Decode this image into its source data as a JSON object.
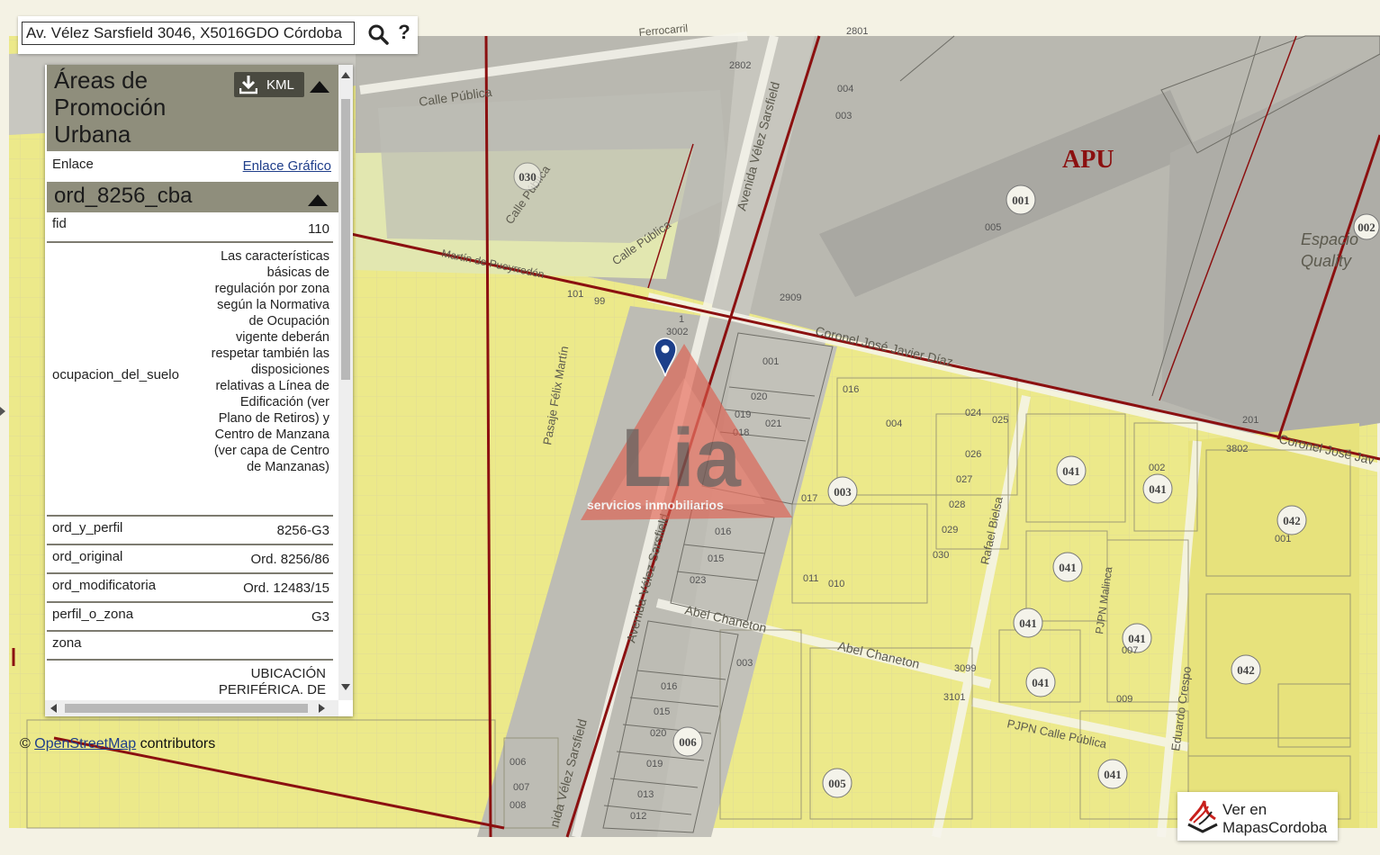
{
  "search": {
    "value": "Av. Vélez Sarsfield 3046, X5016GDO Córdoba",
    "help_label": "?"
  },
  "panel": {
    "title": "Áreas de Promoción Urbana",
    "kml_label": "KML",
    "enlace_label": "Enlace",
    "enlace_link": "Enlace Gráfico",
    "layer_title": "ord_8256_cba",
    "fields": {
      "fid": {
        "key": "fid",
        "value": "110"
      },
      "ocupacion_del_suelo": {
        "key": "ocupacion_del_suelo",
        "value": "Las características básicas de regulación por zona según la Normativa de Ocupación vigente deberán respetar también las disposiciones relativas a Línea de Edificación (ver Plano de Retiros) y Centro de Manzana (ver capa de Centro de Manzanas)"
      },
      "ord_y_perfil": {
        "key": "ord_y_perfil",
        "value": "8256-G3"
      },
      "ord_original": {
        "key": "ord_original",
        "value": "Ord. 8256/86"
      },
      "ord_modificatoria": {
        "key": "ord_modificatoria",
        "value": "Ord. 12483/15"
      },
      "perfil_o_zona": {
        "key": "perfil_o_zona",
        "value": "G3"
      },
      "zona": {
        "key": "zona",
        "value": "UBICACIÓN PERIFÉRICA. DE"
      }
    }
  },
  "attribution": {
    "prefix": "©",
    "link": "OpenStreetMap",
    "suffix": "contributors"
  },
  "mapas_button": {
    "line1": "Ver en",
    "line2": "MapasCordoba"
  },
  "map": {
    "zone_label": "APU",
    "streets": {
      "calle_publica_1": "Calle Pública",
      "calle_publica_2": "Calle Pública",
      "calle_publica_3": "Calle Pública",
      "avenida_vs_1": "Avenida Vélez Sarsfield",
      "avenida_vs_2": "Avenida Vélez Sarsfield",
      "avenida_vs_3": "nida Vélez Sarsfield",
      "coronel_diaz_1": "Coronel José Javier Díaz",
      "coronel_diaz_2": "Coronel José Jav",
      "abel_1": "Abel Chaneton",
      "abel_2": "Abel Chaneton",
      "pasaje": "Pasaje Félix Martín",
      "martin": "Martín de Pueyrredón",
      "rafael": "Rafael Bielsa",
      "eduardo": "Eduardo Crespo",
      "pjpn": "PJPN Calle Pública",
      "pjpn2": "PJPN Malinca",
      "ferrocarril": "Ferrocarril",
      "espacio": "Espacio",
      "quality": "Quality"
    },
    "circles": [
      "001",
      "002",
      "030",
      "003",
      "041",
      "041",
      "041",
      "041",
      "041",
      "041",
      "041",
      "042",
      "042",
      "006",
      "005",
      "041",
      "041"
    ],
    "parcels": [
      "004",
      "003",
      "005",
      "001",
      "020",
      "019",
      "021",
      "018",
      "017",
      "016",
      "015",
      "023",
      "016",
      "015",
      "020",
      "019",
      "013",
      "012",
      "006",
      "007",
      "008",
      "2802",
      "2801",
      "3002",
      "3101",
      "2909",
      "99",
      "101",
      "1",
      "201",
      "3802",
      "3099",
      "016",
      "004",
      "024",
      "025",
      "026",
      "027",
      "028",
      "029",
      "030",
      "010",
      "011",
      "002",
      "007",
      "009",
      "003",
      "001"
    ],
    "watermark": {
      "letters": "Lia",
      "caption": "servicios inmobiliarios"
    }
  },
  "colors": {
    "map_yellow": "#ece98a",
    "map_gray": "#b7b7b0",
    "zone_line": "#8b1010",
    "panel_header": "#8f8e7c",
    "link": "#1f3e8a",
    "watermark_red": "#e05a4a"
  }
}
